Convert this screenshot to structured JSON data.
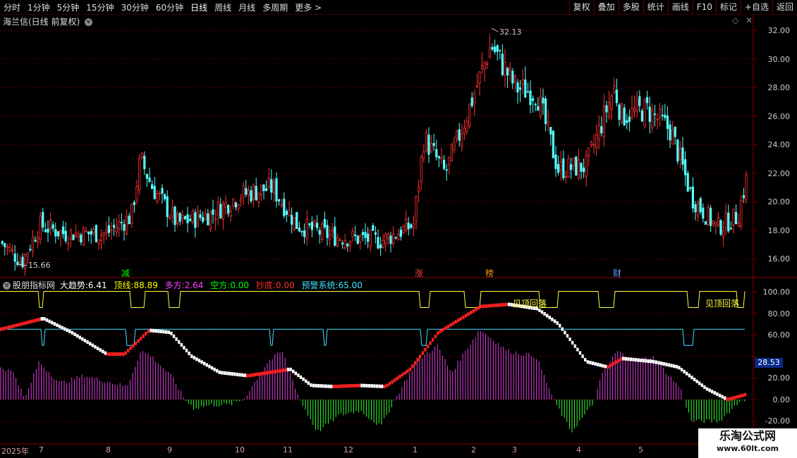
{
  "toolbar": {
    "periods": [
      "分时",
      "1分钟",
      "5分钟",
      "15分钟",
      "30分钟",
      "60分钟",
      "日线",
      "周线",
      "月线",
      "多周期",
      "更多 >"
    ],
    "active_period": "日线",
    "actions": [
      "复权",
      "叠加",
      "多股",
      "统计",
      "画线",
      "F10",
      "标记",
      "+自选",
      "返回"
    ]
  },
  "main": {
    "title": "海兰信(日线 前复权)",
    "y_ticks": [
      "32.00",
      "30.00",
      "28.00",
      "26.00",
      "24.00",
      "22.00",
      "20.00",
      "18.00",
      "16.00"
    ],
    "high_label": "32.13",
    "low_label": "15.66",
    "event_marks": [
      {
        "text": "减",
        "color": "#00ff00"
      },
      {
        "text": "涨",
        "color": "#ff4040"
      },
      {
        "text": "榜",
        "color": "#ff9900"
      },
      {
        "text": "财",
        "color": "#5aa0ff"
      }
    ]
  },
  "indicator": {
    "name": "股朋指标网",
    "fields": [
      {
        "label": "大趋势:",
        "value": "6.41",
        "color": "#ffffff"
      },
      {
        "label": "顶线:",
        "value": "88.89",
        "color": "#ffff00"
      },
      {
        "label": "多方:",
        "value": "2.64",
        "color": "#ff40ff"
      },
      {
        "label": "空方:",
        "value": "0.00",
        "color": "#00ff00"
      },
      {
        "label": "抄底:",
        "value": "0.00",
        "color": "#ff3030"
      },
      {
        "label": "预警系统:",
        "value": "65.00",
        "color": "#40e0ff"
      }
    ],
    "y_ticks": [
      "100.00",
      "80.00",
      "60.00",
      "40.00",
      "20.00",
      "0.00",
      "-20.00"
    ],
    "current_value": "28.53",
    "annotations": [
      "见顶回落",
      "见顶回落"
    ]
  },
  "time_axis": [
    "2025年",
    "7",
    "8",
    "9",
    "10",
    "11",
    "12",
    "1",
    "2",
    "3",
    "4",
    "5"
  ],
  "watermark": {
    "line1": "乐淘公式网",
    "line2": "www.60lt.com"
  }
}
